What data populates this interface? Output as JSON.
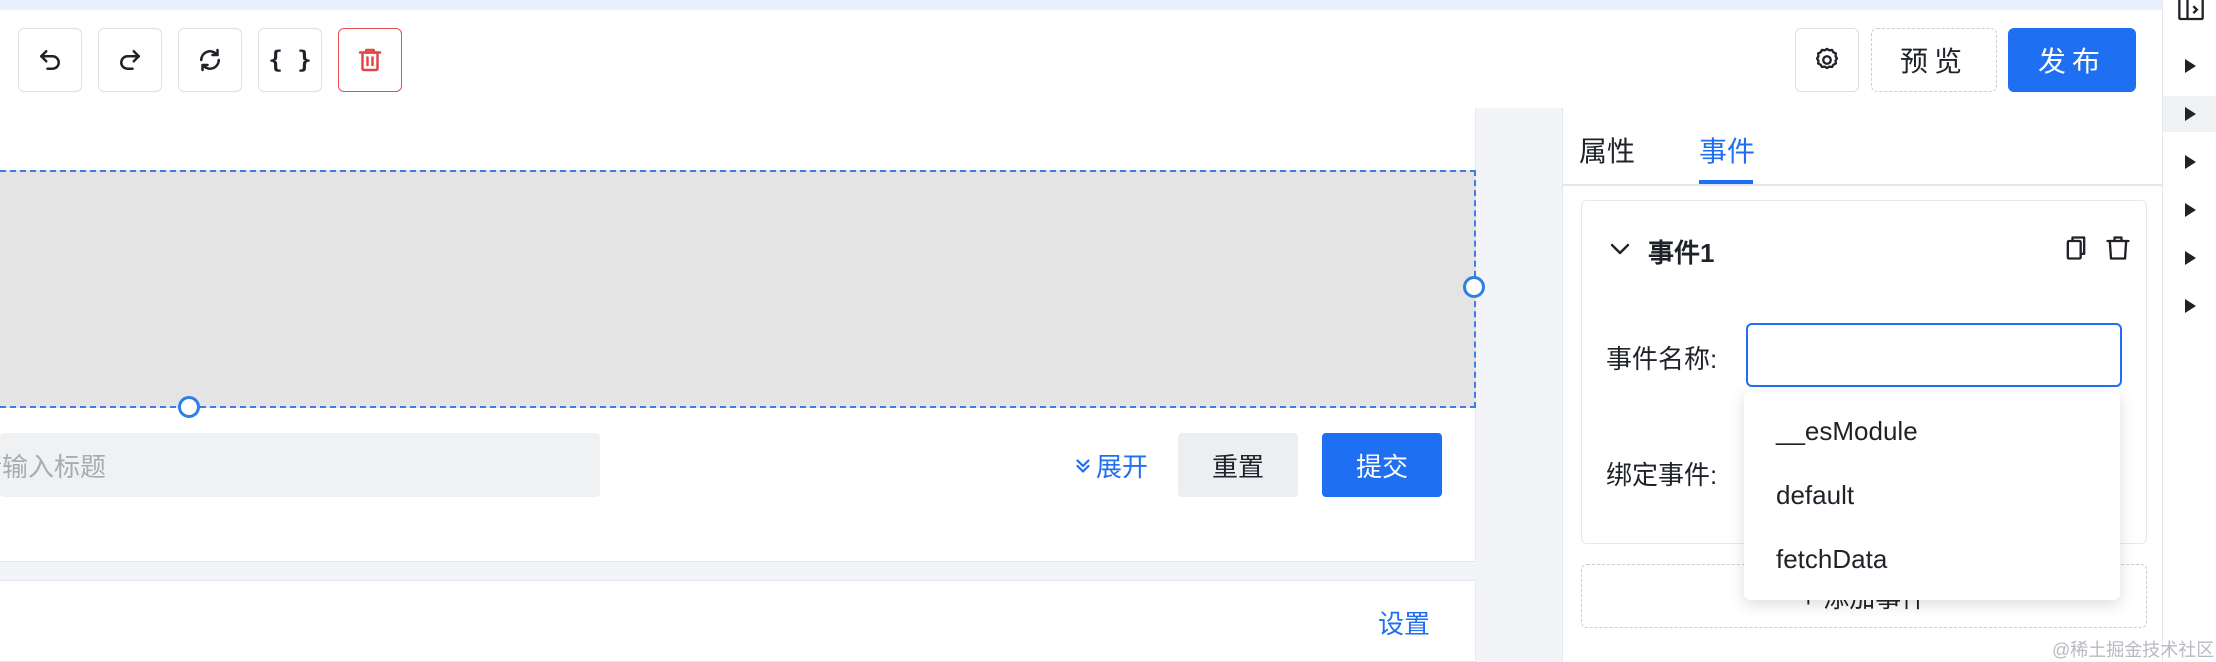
{
  "toolbar": {
    "undo_icon": "undo-icon",
    "redo_icon": "redo-icon",
    "refresh_icon": "refresh-icon",
    "code_label": "{ }",
    "delete_icon": "trash-icon",
    "settings_icon": "gear-icon",
    "preview_label": "预览",
    "publish_label": "发布"
  },
  "canvas": {
    "search_placeholder": "请输入标题",
    "expand_label": "展开",
    "reset_label": "重置",
    "submit_label": "提交",
    "settings_label": "设置"
  },
  "panel": {
    "tabs": [
      {
        "label": "属性",
        "active": false
      },
      {
        "label": "事件",
        "active": true
      }
    ],
    "event": {
      "title": "事件1",
      "name_label": "事件名称:",
      "name_value": "",
      "bind_label": "绑定事件:"
    },
    "add_event_label": "+ 添加事件",
    "dropdown_options": [
      "__esModule",
      "default",
      "fetchData"
    ]
  },
  "watermark": "@稀土掘金技术社区",
  "colors": {
    "accent": "#1f6ff2",
    "danger": "#e04848"
  }
}
